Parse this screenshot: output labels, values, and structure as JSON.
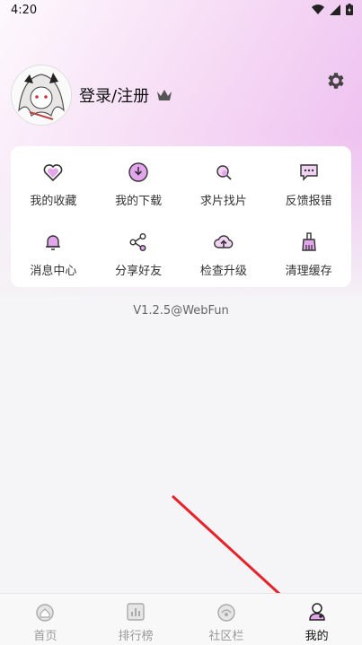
{
  "status_bar": {
    "time": "4:20"
  },
  "profile": {
    "login_label": "登录/注册"
  },
  "menu": {
    "items": [
      {
        "label": "我的收藏",
        "icon": "heart-icon"
      },
      {
        "label": "我的下载",
        "icon": "download-icon"
      },
      {
        "label": "求片找片",
        "icon": "search-film-icon"
      },
      {
        "label": "反馈报错",
        "icon": "feedback-icon"
      },
      {
        "label": "消息中心",
        "icon": "bell-icon"
      },
      {
        "label": "分享好友",
        "icon": "share-icon"
      },
      {
        "label": "检查升级",
        "icon": "upgrade-cloud-icon"
      },
      {
        "label": "清理缓存",
        "icon": "broom-icon"
      }
    ]
  },
  "version": "V1.2.5@WebFun",
  "tabs": [
    {
      "label": "首页",
      "icon": "home-icon",
      "active": false
    },
    {
      "label": "排行榜",
      "icon": "ranking-icon",
      "active": false
    },
    {
      "label": "社区栏",
      "icon": "community-icon",
      "active": false
    },
    {
      "label": "我的",
      "icon": "profile-icon",
      "active": true
    }
  ],
  "colors": {
    "accent": "#e3a6ec",
    "arrow": "#e8222a"
  }
}
